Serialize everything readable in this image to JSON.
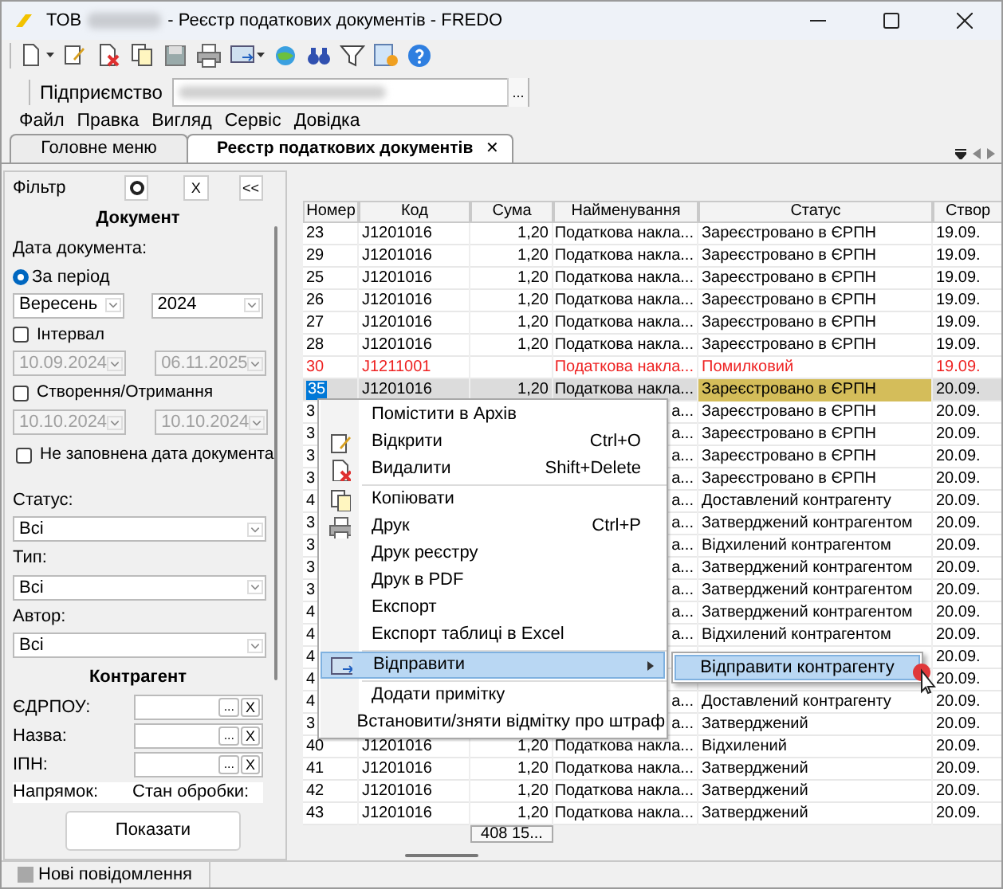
{
  "window": {
    "title_prefix": "ТОВ",
    "title": "- Реєстр податкових документів - FREDO"
  },
  "company": {
    "label": "Підприємство",
    "button": "..."
  },
  "menu_bar": [
    "Файл",
    "Правка",
    "Вигляд",
    "Сервіс",
    "Довідка"
  ],
  "tabs": [
    {
      "label": "Головне меню",
      "selected": false
    },
    {
      "label": "Реєстр податкових документів",
      "selected": true,
      "close": "✕"
    }
  ],
  "filter": {
    "title": "Фільтр",
    "buttons": [
      "X",
      "<<"
    ],
    "document": {
      "heading": "Документ",
      "date_label": "Дата документа:",
      "period": {
        "label": "За період",
        "selected": true,
        "month": "Вересень",
        "year": "2024"
      },
      "interval": {
        "label": "Інтервал",
        "checked": false,
        "from": "10.09.2024",
        "to": "06.11.2025"
      },
      "created": {
        "label": "Створення/Отримання",
        "checked": false,
        "from": "10.10.2024",
        "to": "10.10.2024"
      },
      "no_date": {
        "label": "Не заповнена дата документа",
        "checked": false
      }
    },
    "selects": [
      {
        "label": "Статус:",
        "value": "Всі"
      },
      {
        "label": "Тип:",
        "value": "Всі"
      },
      {
        "label": "Автор:",
        "value": "Всі"
      }
    ],
    "counterparty": {
      "heading": "Контрагент",
      "fields": [
        {
          "label": "ЄДРПОУ:",
          "button": "...",
          "clear": "X"
        },
        {
          "label": "Назва:",
          "button": "...",
          "clear": "X"
        },
        {
          "label": "ІПН:",
          "button": "...",
          "clear": "X"
        }
      ]
    },
    "direction_label": "Напрямок:",
    "processing_label": "Стан обробки:",
    "show_button": "Показати"
  },
  "table": {
    "columns": [
      "Номер",
      "Код",
      "Сума",
      "Найменування",
      "Статус",
      "Створ"
    ],
    "rows": [
      {
        "number": "23",
        "code": "J1201016",
        "sum": "1,20",
        "name": "Податкова накла...",
        "status": "Зареєстровано в ЄРПН",
        "date": "19.09.",
        "selected": false,
        "error": false
      },
      {
        "number": "29",
        "code": "J1201016",
        "sum": "1,20",
        "name": "Податкова накла...",
        "status": "Зареєстровано в ЄРПН",
        "date": "19.09.",
        "selected": false,
        "error": false
      },
      {
        "number": "25",
        "code": "J1201016",
        "sum": "1,20",
        "name": "Податкова накла...",
        "status": "Зареєстровано в ЄРПН",
        "date": "19.09.",
        "selected": false,
        "error": false
      },
      {
        "number": "26",
        "code": "J1201016",
        "sum": "1,20",
        "name": "Податкова накла...",
        "status": "Зареєстровано в ЄРПН",
        "date": "19.09.",
        "selected": false,
        "error": false
      },
      {
        "number": "27",
        "code": "J1201016",
        "sum": "1,20",
        "name": "Податкова накла...",
        "status": "Зареєстровано в ЄРПН",
        "date": "19.09.",
        "selected": false,
        "error": false
      },
      {
        "number": "28",
        "code": "J1201016",
        "sum": "1,20",
        "name": "Податкова накла...",
        "status": "Зареєстровано в ЄРПН",
        "date": "19.09.",
        "selected": false,
        "error": false
      },
      {
        "number": "30",
        "code": "J1211001",
        "name": "Податкова накла...",
        "status": "Помилковий",
        "date": "19.09.",
        "selected": false,
        "error": true
      },
      {
        "number": "35",
        "code": "J1201016",
        "sum": "1,20",
        "name": "Податкова накла...",
        "status": "Зареєстровано в ЄРПН",
        "date": "20.09.",
        "selected": true,
        "error": false
      },
      {
        "number": "3",
        "name": "а...",
        "status": "Зареєстровано в ЄРПН",
        "date": "20.09.",
        "selected": false,
        "error": false
      },
      {
        "number": "3",
        "name": "а...",
        "status": "Зареєстровано в ЄРПН",
        "date": "20.09.",
        "selected": false,
        "error": false
      },
      {
        "number": "3",
        "name": "а...",
        "status": "Зареєстровано в ЄРПН",
        "date": "20.09.",
        "selected": false,
        "error": false
      },
      {
        "number": "3",
        "name": "а...",
        "status": "Зареєстровано в ЄРПН",
        "date": "20.09.",
        "selected": false,
        "error": false
      },
      {
        "number": "4",
        "name": "а...",
        "status": "Доставлений контрагенту",
        "date": "20.09.",
        "selected": false,
        "error": false
      },
      {
        "number": "3",
        "name": "а...",
        "status": "Затверджений контрагентом",
        "date": "20.09.",
        "selected": false,
        "error": false
      },
      {
        "number": "3",
        "name": "а...",
        "status": "Відхилений контрагентом",
        "date": "20.09.",
        "selected": false,
        "error": false
      },
      {
        "number": "3",
        "name": "а...",
        "status": "Затверджений контрагентом",
        "date": "20.09.",
        "selected": false,
        "error": false
      },
      {
        "number": "3",
        "name": "а...",
        "status": "Затверджений контрагентом",
        "date": "20.09.",
        "selected": false,
        "error": false
      },
      {
        "number": "4",
        "name": "а...",
        "status": "Затверджений контрагентом",
        "date": "20.09.",
        "selected": false,
        "error": false
      },
      {
        "number": "4",
        "name": "а...",
        "status": "Відхилений контрагентом",
        "date": "20.09.",
        "selected": false,
        "error": false
      },
      {
        "number": "4",
        "date": "20.09.",
        "selected": false,
        "error": false
      },
      {
        "number": "4",
        "date": "20.09.",
        "selected": false,
        "error": false
      },
      {
        "number": "4",
        "name": "а...",
        "status": "Доставлений контрагенту",
        "date": "20.09.",
        "selected": false,
        "error": false
      },
      {
        "number": "3",
        "name": "а...",
        "status": "Затверджений",
        "date": "20.09.",
        "selected": false,
        "error": false
      },
      {
        "number": "40",
        "code": "J1201016",
        "sum": "1,20",
        "name": "Податкова накла...",
        "status": "Відхилений",
        "date": "20.09.",
        "selected": false,
        "error": false
      },
      {
        "number": "41",
        "code": "J1201016",
        "sum": "1,20",
        "name": "Податкова накла...",
        "status": "Затверджений",
        "date": "20.09.",
        "selected": false,
        "error": false
      },
      {
        "number": "42",
        "code": "J1201016",
        "sum": "1,20",
        "name": "Податкова накла...",
        "status": "Затверджений",
        "date": "20.09.",
        "selected": false,
        "error": false
      },
      {
        "number": "43",
        "code": "J1201016",
        "sum": "1,20",
        "name": "Податкова накла...",
        "status": "Затверджений",
        "date": "20.09.",
        "selected": false,
        "error": false
      }
    ],
    "footer": {
      "sum": "408 15..."
    }
  },
  "context_menu": {
    "groups": [
      [
        {
          "label": "Помістити в Архів",
          "selected": false
        },
        {
          "label": "Відкрити",
          "shortcut": "Ctrl+O",
          "selected": false
        },
        {
          "label": "Видалити",
          "shortcut": "Shift+Delete",
          "selected": false
        }
      ],
      [
        {
          "label": "Копіювати",
          "selected": false
        },
        {
          "label": "Друк",
          "shortcut": "Ctrl+P",
          "selected": false
        },
        {
          "label": "Друк реєстру",
          "selected": false
        },
        {
          "label": "Друк в PDF",
          "selected": false
        },
        {
          "label": "Експорт",
          "selected": false
        },
        {
          "label": "Експорт таблиці в Excel",
          "selected": false
        }
      ],
      [
        {
          "label": "Відправити",
          "selected": true,
          "submenu": true
        }
      ],
      [
        {
          "label": "Додати примітку",
          "selected": false
        },
        {
          "label": "Встановити/зняти відмітку про штраф",
          "selected": false
        }
      ]
    ],
    "submenu": [
      {
        "label": "Відправити контрагенту",
        "selected": true
      }
    ]
  },
  "status_bar": {
    "text": "Нові повідомлення"
  }
}
